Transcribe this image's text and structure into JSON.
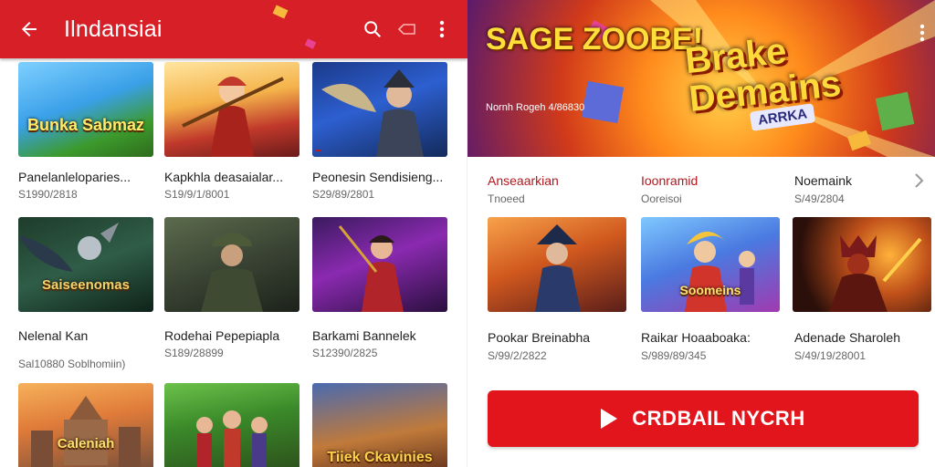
{
  "colors": {
    "accent": "#d61f26",
    "cta": "#e3151c"
  },
  "left": {
    "appbar": {
      "title": "Ilndansiai",
      "icons": [
        "back-arrow-icon",
        "search-icon",
        "tag-icon",
        "more-vert-icon"
      ]
    },
    "rows": [
      [
        {
          "name": "Panelanleloparies...",
          "sub": "S1990/2818",
          "art": "Bunka Sabmaz"
        },
        {
          "name": "Kapkhla deasaialar...",
          "sub": "S19/9/1/8001",
          "art": ""
        },
        {
          "name": "Peonesin Sendisieng...",
          "sub": "S29/89/2801",
          "art": ""
        }
      ],
      [
        {
          "name": "Nelenal Kan",
          "sub": "Sal10880 Soblhomiin)",
          "art": "Saiseenomas"
        },
        {
          "name": "Rodehai Pepepiapla",
          "sub": "S189/28899",
          "art": ""
        },
        {
          "name": "Barkami Bannelek",
          "sub": "S12390/2825",
          "art": ""
        }
      ],
      [
        {
          "name": "",
          "sub": "",
          "art": "Caleniah"
        },
        {
          "name": "",
          "sub": "",
          "art": ""
        },
        {
          "name": "",
          "sub": "",
          "art": "Tiiek Ckavinies"
        }
      ]
    ]
  },
  "right": {
    "hero": {
      "left_title": "SAGE ZOOBE!",
      "left_sub": "Nornh Rogeh 4/86830",
      "title": "Brake Demains",
      "tag": "ARRKA"
    },
    "top_list": [
      {
        "name": "Anseaarkian",
        "sub": "Tnoeed",
        "red": true
      },
      {
        "name": "Ioonramid",
        "sub": "Ooreisoi",
        "red": true
      },
      {
        "name": "Noemaink",
        "sub": "S/49/2804",
        "red": false
      }
    ],
    "thumb_art": [
      "",
      "Soomeins",
      ""
    ],
    "bottom_list": [
      {
        "name": "Pookar Breinabha",
        "sub": "S/99/2/2822"
      },
      {
        "name": "Raikar Hoaaboaka:",
        "sub": "S/989/89/345"
      },
      {
        "name": "Adenade Sharoleh",
        "sub": "S/49/19/28001"
      }
    ],
    "cta": "CRDBAIL NYCRH"
  }
}
